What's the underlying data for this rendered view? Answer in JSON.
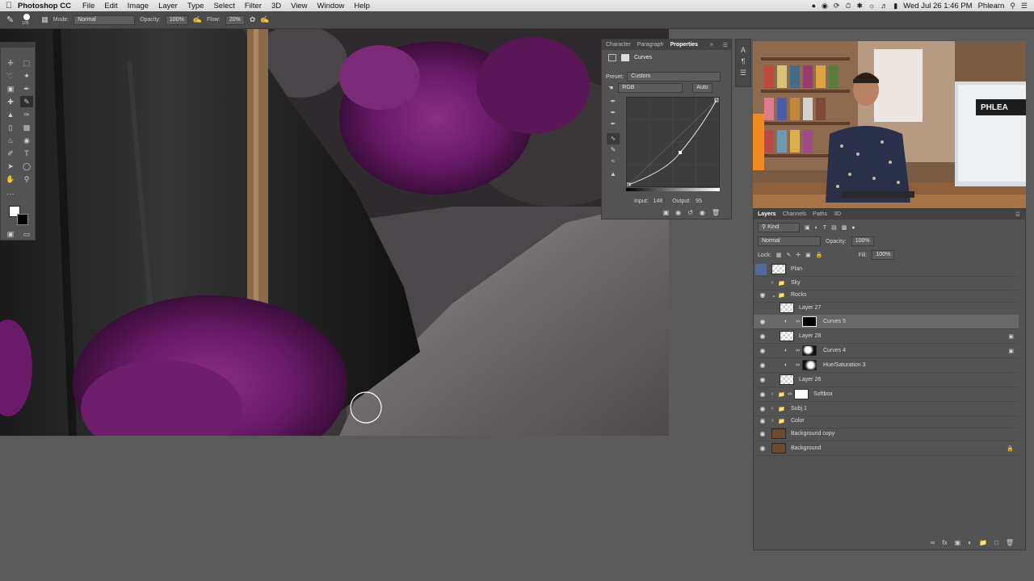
{
  "menubar": {
    "app": "Photoshop CC",
    "items": [
      "File",
      "Edit",
      "Image",
      "Layer",
      "Type",
      "Select",
      "Filter",
      "3D",
      "View",
      "Window",
      "Help"
    ],
    "clock": "Wed Jul 26  1:46 PM",
    "user": "Phlearn"
  },
  "options": {
    "brush_size": "105",
    "mode_label": "Mode:",
    "mode_value": "Normal",
    "opacity_label": "Opacity:",
    "opacity_value": "100%",
    "flow_label": "Flow:",
    "flow_value": "20%"
  },
  "properties": {
    "tabs": [
      "Character",
      "Paragraph",
      "Properties"
    ],
    "active_tab": "Properties",
    "title": "Curves",
    "preset_label": "Preset:",
    "preset_value": "Custom",
    "channel_value": "RGB",
    "auto_label": "Auto",
    "input_label": "Input:",
    "input_value": "148",
    "output_label": "Output:",
    "output_value": "95"
  },
  "layers_panel": {
    "tabs": [
      "Layers",
      "Channels",
      "Paths",
      "3D"
    ],
    "filter_label": "Kind",
    "blend_mode": "Normal",
    "opacity_label": "Opacity:",
    "opacity_value": "100%",
    "lock_label": "Lock:",
    "fill_label": "Fill:",
    "fill_value": "100%",
    "layers": [
      {
        "name": "Plan",
        "visible": false,
        "selected": false
      },
      {
        "name": "Sky",
        "visible": false,
        "type": "group"
      },
      {
        "name": "Rocks",
        "visible": true,
        "type": "group"
      },
      {
        "name": "Layer 27",
        "visible": false
      },
      {
        "name": "Curves 5",
        "visible": true,
        "selected": true
      },
      {
        "name": "Layer 28",
        "visible": true
      },
      {
        "name": "Curves 4",
        "visible": true
      },
      {
        "name": "Hue/Saturation 3",
        "visible": true
      },
      {
        "name": "Layer 26",
        "visible": true
      },
      {
        "name": "Softbox",
        "visible": true,
        "type": "group"
      },
      {
        "name": "Subj 1",
        "visible": true,
        "type": "group"
      },
      {
        "name": "Color",
        "visible": true,
        "type": "group"
      },
      {
        "name": "Background copy",
        "visible": true
      },
      {
        "name": "Background",
        "visible": true,
        "locked": true
      }
    ]
  },
  "video_overlay": {
    "monitor_label": "PHLEA"
  }
}
